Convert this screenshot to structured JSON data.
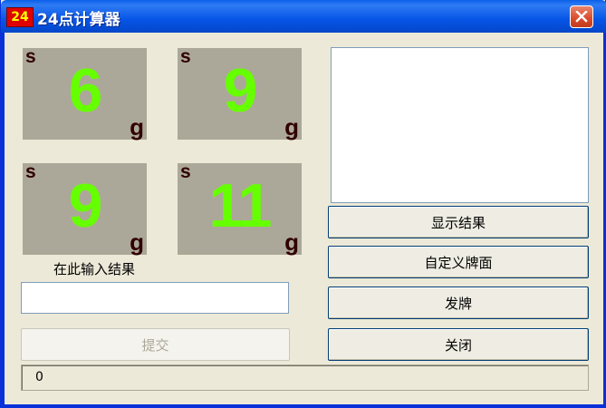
{
  "window": {
    "app_icon_text": "24",
    "title": "24点计算器"
  },
  "cards": [
    {
      "suit": "s",
      "rank": "6",
      "mark": "g"
    },
    {
      "suit": "s",
      "rank": "9",
      "mark": "g"
    },
    {
      "suit": "s",
      "rank": "9",
      "mark": "g"
    },
    {
      "suit": "s",
      "rank": "11",
      "mark": "g"
    }
  ],
  "input": {
    "label": "在此输入结果",
    "value": ""
  },
  "buttons": {
    "submit": "提交",
    "show_result": "显示结果",
    "custom_cards": "自定义牌面",
    "deal": "发牌",
    "close": "关闭"
  },
  "status": {
    "text": "0"
  },
  "colors": {
    "rank": "#66ff00",
    "card_bg": "#aca899",
    "suit": "#300000"
  }
}
